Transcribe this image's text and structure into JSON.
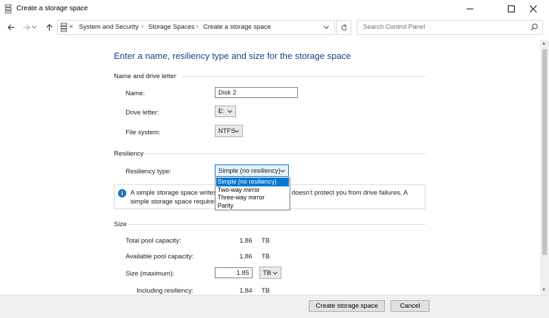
{
  "window": {
    "title": "Create a storage space",
    "controls": [
      "minimize-icon",
      "maximize-icon",
      "close-icon"
    ]
  },
  "nav": {
    "breadcrumb_prefix": "«",
    "breadcrumbs": [
      "System and Security",
      "Storage Spaces",
      "Create a storage space"
    ],
    "separator": "›",
    "search_placeholder": "Search Control Panel"
  },
  "page": {
    "heading": "Enter a name, resiliency type and size for the storage space"
  },
  "name_section": {
    "title": "Name and drive letter",
    "name_label": "Name:",
    "name_value": "Disk 2",
    "drive_letter_label": "Drive letter:",
    "drive_letter_value": "E:",
    "file_system_label": "File system:",
    "file_system_value": "NTFS"
  },
  "resiliency_section": {
    "title": "Resiliency",
    "type_label": "Resiliency type:",
    "type_value": "Simple (no resiliency)",
    "options": [
      "Simple (no resiliency)",
      "Two-way mirror",
      "Three-way mirror",
      "Parity"
    ],
    "info_line1_start": "A simple storage space writes",
    "info_line1_end": "doesn't protect you from drive failures. A",
    "info_line2_start": "simple storage space requires"
  },
  "size_section": {
    "title": "Size",
    "total_label": "Total pool capacity:",
    "total_value": "1.86",
    "total_unit": "TB",
    "available_label": "Available pool capacity:",
    "available_value": "1.86",
    "available_unit": "TB",
    "size_label": "Size (maximum):",
    "size_value": "1.85",
    "size_unit": "TB",
    "including_label": "Including resiliency:",
    "including_value": "1.84",
    "including_unit": "TB"
  },
  "footer": {
    "create_label": "Create storage space",
    "cancel_label": "Cancel"
  },
  "colors": {
    "heading": "#1e3d8c",
    "accent": "#0078d7",
    "info_icon": "#1a6fc2"
  }
}
